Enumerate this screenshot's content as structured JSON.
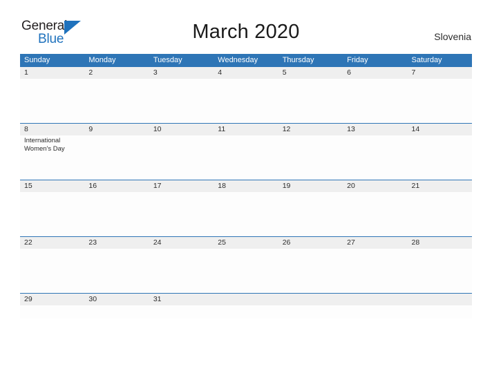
{
  "logo": {
    "word_one": "General",
    "word_two": "Blue",
    "triangle_color": "#1f72bd",
    "icon": "triangle-icon"
  },
  "header": {
    "title": "March 2020",
    "country": "Slovenia"
  },
  "theme": {
    "header_blue": "#2e75b6",
    "date_band_grey": "#efefef",
    "text_dark": "#2b2b2b",
    "page_background": "#ffffff"
  },
  "calendar": {
    "weekdays": [
      "Sunday",
      "Monday",
      "Tuesday",
      "Wednesday",
      "Thursday",
      "Friday",
      "Saturday"
    ],
    "weeks": [
      {
        "dates": [
          "1",
          "2",
          "3",
          "4",
          "5",
          "6",
          "7"
        ],
        "events": [
          "",
          "",
          "",
          "",
          "",
          "",
          ""
        ]
      },
      {
        "dates": [
          "8",
          "9",
          "10",
          "11",
          "12",
          "13",
          "14"
        ],
        "events": [
          "International Women's Day",
          "",
          "",
          "",
          "",
          "",
          ""
        ]
      },
      {
        "dates": [
          "15",
          "16",
          "17",
          "18",
          "19",
          "20",
          "21"
        ],
        "events": [
          "",
          "",
          "",
          "",
          "",
          "",
          ""
        ]
      },
      {
        "dates": [
          "22",
          "23",
          "24",
          "25",
          "26",
          "27",
          "28"
        ],
        "events": [
          "",
          "",
          "",
          "",
          "",
          "",
          ""
        ]
      },
      {
        "dates": [
          "29",
          "30",
          "31",
          "",
          "",
          "",
          ""
        ],
        "events": [
          "",
          "",
          "",
          "",
          "",
          "",
          ""
        ]
      }
    ]
  }
}
